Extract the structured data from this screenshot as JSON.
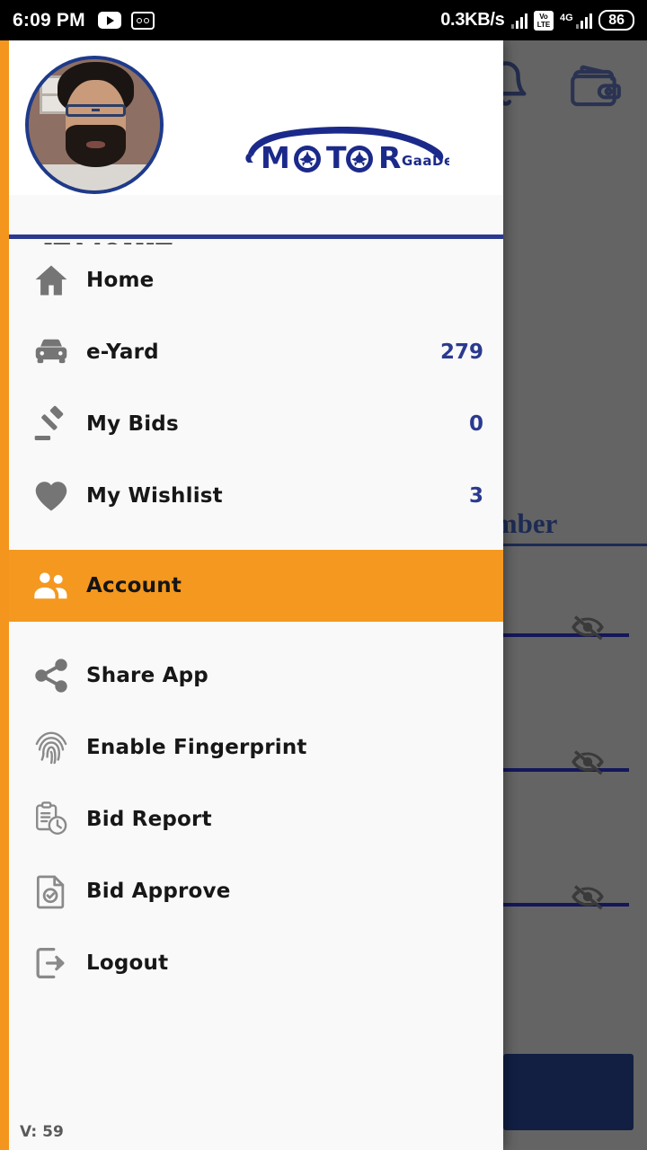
{
  "status_bar": {
    "time": "6:09 PM",
    "icons_left": [
      "youtube-icon",
      "voicemail-icon"
    ],
    "network_speed": "0.3KB/s",
    "volte_top": "Vo",
    "volte_bottom": "LTE",
    "network_type": "4G",
    "battery": "86"
  },
  "background": {
    "bell_icon": "notification-bell-icon",
    "wallet_icon": "wallet-icon",
    "field_label": "le Number",
    "eye_icon": "eye-off-icon",
    "submit_button": ""
  },
  "drawer": {
    "profile": {
      "name": "IT.MOHIT",
      "avatar": "user-avatar"
    },
    "brand": {
      "name": "MOTOR",
      "suffix": "GaaDee"
    },
    "menu": [
      {
        "label": "Home",
        "icon": "home-icon",
        "badge": ""
      },
      {
        "label": "e-Yard",
        "icon": "car-icon",
        "badge": "279"
      },
      {
        "label": "My Bids",
        "icon": "gavel-icon",
        "badge": "0"
      },
      {
        "label": "My Wishlist",
        "icon": "heart-icon",
        "badge": "3"
      },
      {
        "label": "Account",
        "icon": "people-icon",
        "badge": ""
      },
      {
        "label": "Share App",
        "icon": "share-icon",
        "badge": ""
      },
      {
        "label": "Enable Fingerprint",
        "icon": "fingerprint-icon",
        "badge": ""
      },
      {
        "label": "Bid Report",
        "icon": "clipboard-clock-icon",
        "badge": ""
      },
      {
        "label": "Bid Approve",
        "icon": "document-check-icon",
        "badge": ""
      },
      {
        "label": "Logout",
        "icon": "logout-icon",
        "badge": ""
      }
    ],
    "version": "V: 59"
  },
  "colors": {
    "accent_orange": "#f4981f",
    "brand_navy": "#2b3a8f",
    "badge_blue": "#2b3a8f",
    "drawer_bg": "#f9f9f9",
    "scrim": "#646464"
  }
}
